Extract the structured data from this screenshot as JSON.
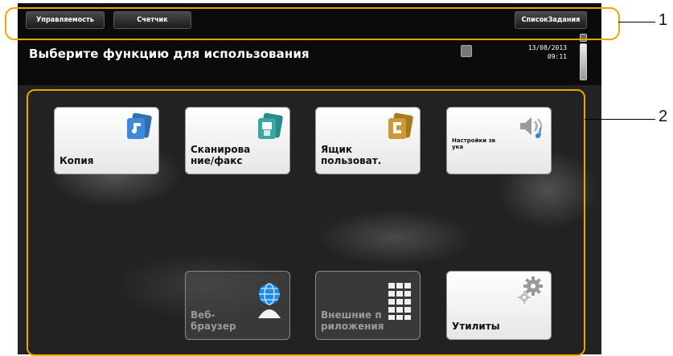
{
  "topbar": {
    "utility_label": "Управляемость",
    "counter_label": "Счетчик",
    "joblist_label": "СписокЗадания"
  },
  "header": {
    "title": "Выберите функцию для использования",
    "date": "13/08/2013",
    "time": "09:11"
  },
  "tiles": {
    "copy": {
      "label": "Копия",
      "icon": "copy-icon",
      "enabled": true
    },
    "scan": {
      "label": "Сканирова\nние/факс",
      "icon": "scan-fax-icon",
      "enabled": true
    },
    "userbox": {
      "label": "Ящик\nпользоват.",
      "icon": "user-box-icon",
      "enabled": true
    },
    "sound": {
      "label": "Настройки зв\nука",
      "icon": "speaker-icon",
      "enabled": true
    },
    "web": {
      "label": "Веб-\nбраузер",
      "icon": "globe-icon",
      "enabled": false
    },
    "apps": {
      "label": "Внешние п\nриложения",
      "icon": "apps-grid-icon",
      "enabled": false
    },
    "utility": {
      "label": "Утилиты",
      "icon": "gear-icon",
      "enabled": true
    }
  },
  "callouts": {
    "one": "1",
    "two": "2"
  },
  "colors": {
    "highlight": "#f0a400",
    "panel": "#0b0b0b"
  }
}
